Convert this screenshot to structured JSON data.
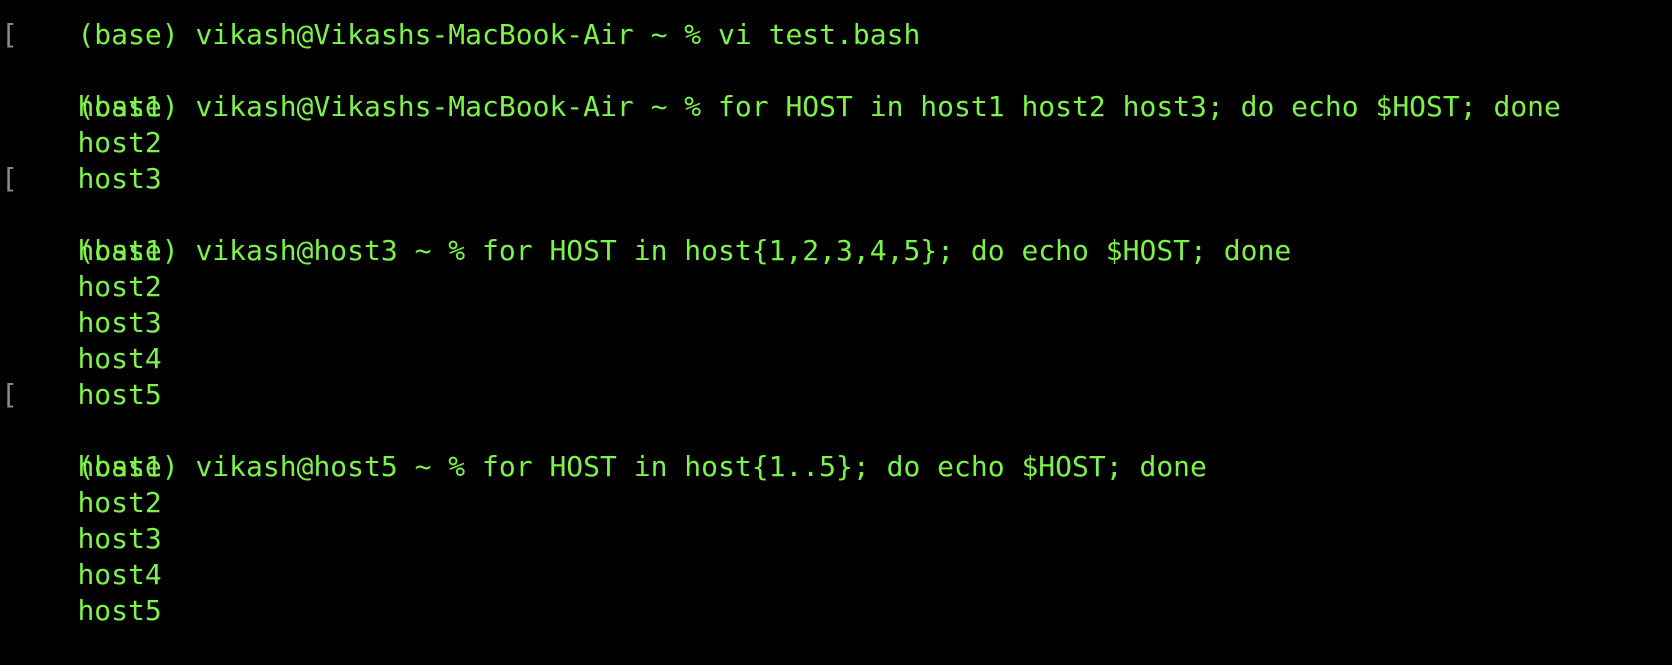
{
  "terminal": {
    "partial_top_line": "(base) vikash@Vikashs-MacBook-Air ~ % vi test.bash",
    "lines": [
      {
        "mark": "[",
        "text": "(base) vikash@Vikashs-MacBook-Air ~ % for HOST in host1 host2 host3; do echo $HOST; done"
      },
      {
        "mark": "",
        "text": "host1"
      },
      {
        "mark": "",
        "text": "host2"
      },
      {
        "mark": "",
        "text": "host3"
      },
      {
        "mark": "[",
        "text": "(base) vikash@host3 ~ % for HOST in host{1,2,3,4,5}; do echo $HOST; done"
      },
      {
        "mark": "",
        "text": "host1"
      },
      {
        "mark": "",
        "text": "host2"
      },
      {
        "mark": "",
        "text": "host3"
      },
      {
        "mark": "",
        "text": "host4"
      },
      {
        "mark": "",
        "text": "host5"
      },
      {
        "mark": "[",
        "text": "(base) vikash@host5 ~ % for HOST in host{1..5}; do echo $HOST; done"
      },
      {
        "mark": "",
        "text": "host1"
      },
      {
        "mark": "",
        "text": "host2"
      },
      {
        "mark": "",
        "text": "host3"
      },
      {
        "mark": "",
        "text": "host4"
      },
      {
        "mark": "",
        "text": "host5"
      }
    ]
  },
  "colors": {
    "background": "#000000",
    "text": "#7CF24A",
    "mark": "#8a8a8a"
  }
}
